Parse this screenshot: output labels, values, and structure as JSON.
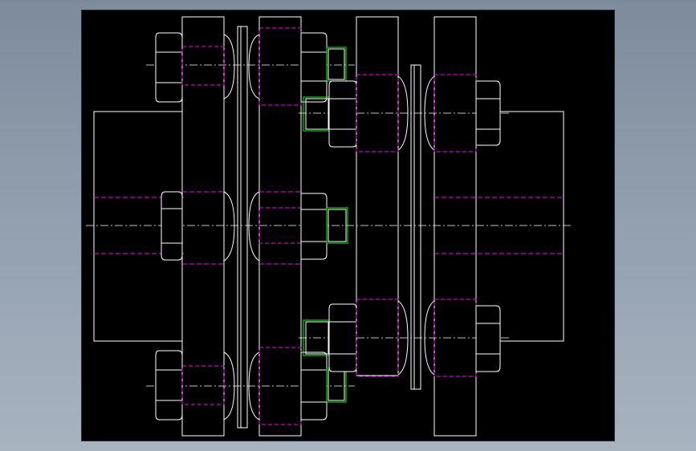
{
  "viewport": {
    "background": "#000000",
    "canvas_background": "#8c9aab"
  },
  "colors": {
    "outline": "#ffffff",
    "hidden_line": "#ff00ff",
    "thread": "#00ff00",
    "centerline": "#ffffff"
  },
  "drawing": {
    "kind": "flange-coupling-section"
  }
}
